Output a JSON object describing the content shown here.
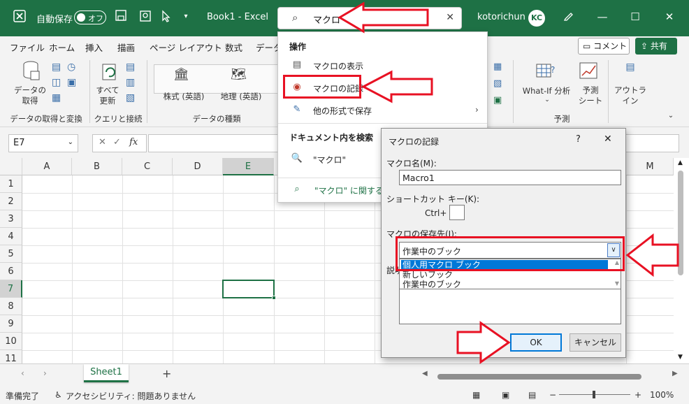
{
  "titlebar": {
    "excel_icon": "excel-logo-icon",
    "autosave_label": "自動保存",
    "autosave_state": "オフ",
    "doc_title": "Book1  -  Excel",
    "search_query": "マクロ",
    "user_name": "kotorichun",
    "avatar_initials": "KC"
  },
  "ribbon_tabs": [
    "ファイル",
    "ホーム",
    "挿入",
    "描画",
    "ページ レイアウト",
    "数式",
    "データ"
  ],
  "ribbon_actions": {
    "comment": "コメント",
    "share": "共有"
  },
  "ribbon": {
    "get_data": "データの\n取得",
    "refresh_all": "すべて\n更新",
    "group_get_transform": "データの取得と変換",
    "group_queries": "クエリと接続",
    "stocks": "株式 (英語)",
    "geography": "地理 (英語)",
    "group_data_types": "データの種類",
    "whatif": "What-If 分析",
    "forecast_sheet": "予測\nシート",
    "outline": "アウトラ\nイン",
    "group_forecast": "予測"
  },
  "formula_bar": {
    "name_box": "E7",
    "fx": "fx"
  },
  "grid": {
    "columns": [
      "A",
      "B",
      "C",
      "D",
      "E",
      "M"
    ],
    "rows": [
      "1",
      "2",
      "3",
      "4",
      "5",
      "6",
      "7",
      "8",
      "9",
      "10",
      "11"
    ],
    "selected_col": "E",
    "selected_row": "7"
  },
  "sheet_tabs": {
    "active": "Sheet1",
    "add": "+"
  },
  "status": {
    "ready": "準備完了",
    "accessibility": "アクセシビリティ: 問題ありません",
    "zoom": "100%"
  },
  "search_dropdown": {
    "section_actions": "操作",
    "items": [
      "マクロの表示",
      "マクロの記録",
      "他の形式で保存"
    ],
    "section_doc": "ドキュメント内を検索",
    "doc_item": "\"マクロ\"",
    "help_item": "\"マクロ\" に関するその"
  },
  "dialog": {
    "title": "マクロの記録",
    "help": "?",
    "macro_name_label": "マクロ名(M):",
    "macro_name_value": "Macro1",
    "shortcut_label": "ショートカット キー(K):",
    "ctrl_label": "Ctrl+",
    "store_label": "マクロの保存先(I):",
    "store_selected": "作業中のブック",
    "store_options": [
      "個人用マクロ ブック",
      "新しいブック",
      "作業中のブック"
    ],
    "description_label": "説明",
    "ok": "OK",
    "cancel": "キャンセル"
  }
}
